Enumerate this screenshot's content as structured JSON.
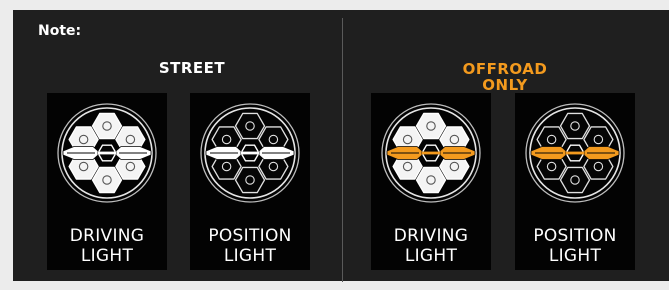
{
  "note_label": "Note:",
  "sections": [
    {
      "title_lines": [
        "STREET",
        ""
      ],
      "title_color": "#ffffff",
      "cards": [
        {
          "line1": "DRIVING",
          "line2": "LIGHT",
          "mode": "driving",
          "accent": "#ffffff"
        },
        {
          "line1": "POSITION",
          "line2": "LIGHT",
          "mode": "position",
          "accent": "#ffffff"
        }
      ]
    },
    {
      "title_lines": [
        "OFFROAD",
        "ONLY"
      ],
      "title_color": "#f39a1e",
      "cards": [
        {
          "line1": "DRIVING",
          "line2": "LIGHT",
          "mode": "driving",
          "accent": "#f39a1e"
        },
        {
          "line1": "POSITION",
          "line2": "LIGHT",
          "mode": "position",
          "accent": "#f39a1e"
        }
      ]
    }
  ],
  "icons": {
    "lamp": "headlight-pod-icon"
  }
}
